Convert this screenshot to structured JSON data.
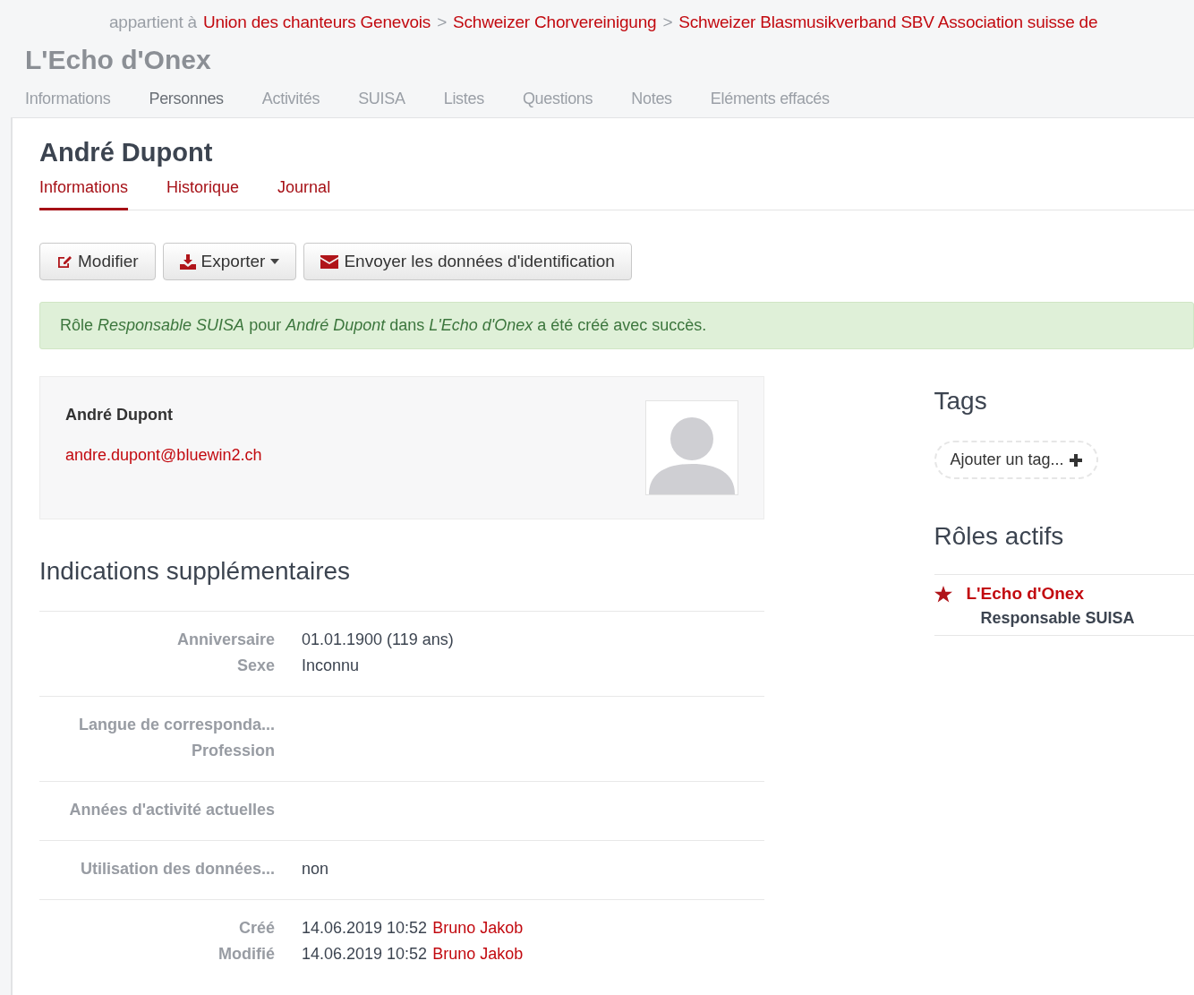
{
  "breadcrumb": {
    "prefix": "appartient à",
    "separator": ">",
    "links": [
      "Union des chanteurs Genevois",
      "Schweizer Chorvereinigung",
      "Schweizer Blasmusikverband SBV Association suisse de"
    ]
  },
  "group_title": "L'Echo d'Onex",
  "nav_tabs": [
    {
      "label": "Informations",
      "selected": false
    },
    {
      "label": "Personnes",
      "selected": true
    },
    {
      "label": "Activités",
      "selected": false
    },
    {
      "label": "SUISA",
      "selected": false
    },
    {
      "label": "Listes",
      "selected": false
    },
    {
      "label": "Questions",
      "selected": false
    },
    {
      "label": "Notes",
      "selected": false
    },
    {
      "label": "Eléments effacés",
      "selected": false
    }
  ],
  "person_title": "André Dupont",
  "sub_tabs": [
    {
      "label": "Informations",
      "selected": true
    },
    {
      "label": "Historique",
      "selected": false
    },
    {
      "label": "Journal",
      "selected": false
    }
  ],
  "buttons": [
    {
      "label": "Modifier",
      "kind": "edit",
      "dropdown": false
    },
    {
      "label": "Exporter",
      "kind": "download",
      "dropdown": true
    },
    {
      "label": "Envoyer les données d'identification",
      "kind": "mail",
      "dropdown": false
    }
  ],
  "alert": "Rôle *Responsable SUISA* pour *André Dupont* dans *L'Echo d'Onex* a été créé avec succès.",
  "contact_card": {
    "name": "André Dupont",
    "email": "andre.dupont@bluewin2.ch"
  },
  "details_title": "Indications supplémentaires",
  "detail_groups": [
    {
      "items": [
        {
          "label": "Anniversaire",
          "value": "01.01.1900 (119 ans)"
        },
        {
          "label": "Sexe",
          "value": "Inconnu"
        }
      ]
    },
    {
      "items": [
        {
          "label": "Langue de corresponda..."
        },
        {
          "label": "Profession"
        }
      ]
    },
    {
      "items": [
        {
          "label": "Années d'activité actuelles"
        }
      ]
    },
    {
      "items": [
        {
          "label": "Utilisation des données...",
          "value": "non"
        }
      ]
    },
    {
      "items": [
        {
          "label": "Créé",
          "value": "14.06.2019 10:52",
          "author": "Bruno Jakob"
        },
        {
          "label": "Modifié",
          "value": "14.06.2019 10:52",
          "author": "Bruno Jakob"
        }
      ]
    }
  ],
  "tags": {
    "title": "Tags",
    "add_label": "Ajouter un tag..."
  },
  "roles": {
    "title": "Rôles actifs",
    "items": [
      {
        "group": "L'Echo d'Onex",
        "role": "Responsable SUISA",
        "primary": true
      }
    ]
  }
}
